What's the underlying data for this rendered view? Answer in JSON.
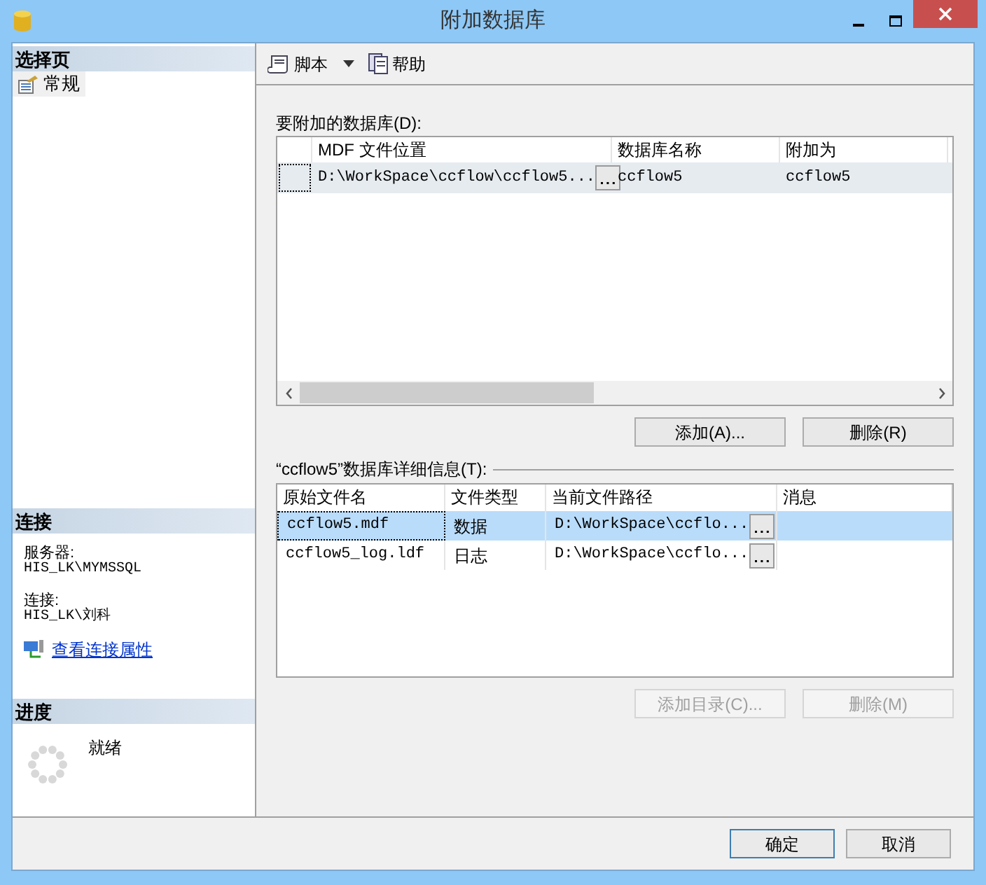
{
  "window": {
    "title": "附加数据库"
  },
  "sidebar": {
    "header": "选择页",
    "items": [
      {
        "label": "常规",
        "selected": true
      }
    ]
  },
  "connection": {
    "header": "连接",
    "server_label": "服务器:",
    "server": "HIS_LK\\MYMSSQL",
    "connection_label": "连接:",
    "connection": "HIS_LK\\刘科",
    "link": "查看连接属性"
  },
  "progress": {
    "header": "进度",
    "status": "就绪"
  },
  "toolbar": [
    {
      "label": "脚本",
      "kind": "dropdown"
    },
    {
      "label": "帮助",
      "kind": "button"
    }
  ],
  "databases": {
    "label": "要附加的数据库(D):",
    "columns": [
      "MDF 文件位置",
      "数据库名称",
      "附加为"
    ],
    "rows": [
      {
        "selected": true,
        "cells": [
          "D:\\WorkSpace\\ccflow\\ccflow5...",
          "ccflow5",
          "ccflow5"
        ]
      }
    ],
    "buttons": [
      {
        "label": "添加(A)...",
        "disabled": false
      },
      {
        "label": "删除(R)",
        "disabled": false
      }
    ]
  },
  "details": {
    "label": "“ccflow5”数据库详细信息(T):",
    "columns": [
      "原始文件名",
      "文件类型",
      "当前文件路径",
      "消息"
    ],
    "rows": [
      {
        "selected": true,
        "cells": [
          "ccflow5.mdf",
          "数据",
          "D:\\WorkSpace\\ccflo..."
        ]
      },
      {
        "selected": false,
        "cells": [
          "ccflow5_log.ldf",
          "日志",
          "D:\\WorkSpace\\ccflo..."
        ]
      }
    ],
    "buttons": [
      {
        "label": "添加目录(C)...",
        "disabled": true
      },
      {
        "label": "删除(M)",
        "disabled": true
      }
    ]
  },
  "footer_buttons": [
    {
      "label": "确定",
      "default": true
    },
    {
      "label": "取消",
      "default": false
    }
  ]
}
